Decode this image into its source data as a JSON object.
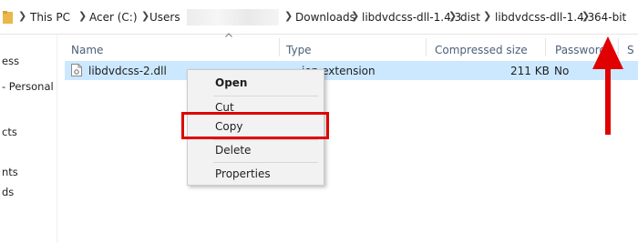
{
  "breadcrumb": {
    "items": [
      "This PC",
      "Acer (C:)",
      "Users",
      "Downloads",
      "libdvdcss-dll-1.4.3",
      "dist",
      "libdvdcss-dll-1.4.3",
      "64-bit"
    ]
  },
  "nav": {
    "items": [
      "ess",
      "- Personal",
      "cts",
      "nts",
      "ds"
    ]
  },
  "columns": {
    "name": "Name",
    "type": "Type",
    "compressed_size": "Compressed size",
    "password": "Password ...",
    "size": "S"
  },
  "file": {
    "name": "libdvdcss-2.dll",
    "type": "ion extension",
    "compressed_size": "211 KB",
    "password": "No"
  },
  "context_menu": {
    "open": "Open",
    "cut": "Cut",
    "copy": "Copy",
    "delete": "Delete",
    "properties": "Properties"
  },
  "colors": {
    "selection": "#cce8ff",
    "highlight": "#e00000",
    "header_text": "#4c607a"
  }
}
